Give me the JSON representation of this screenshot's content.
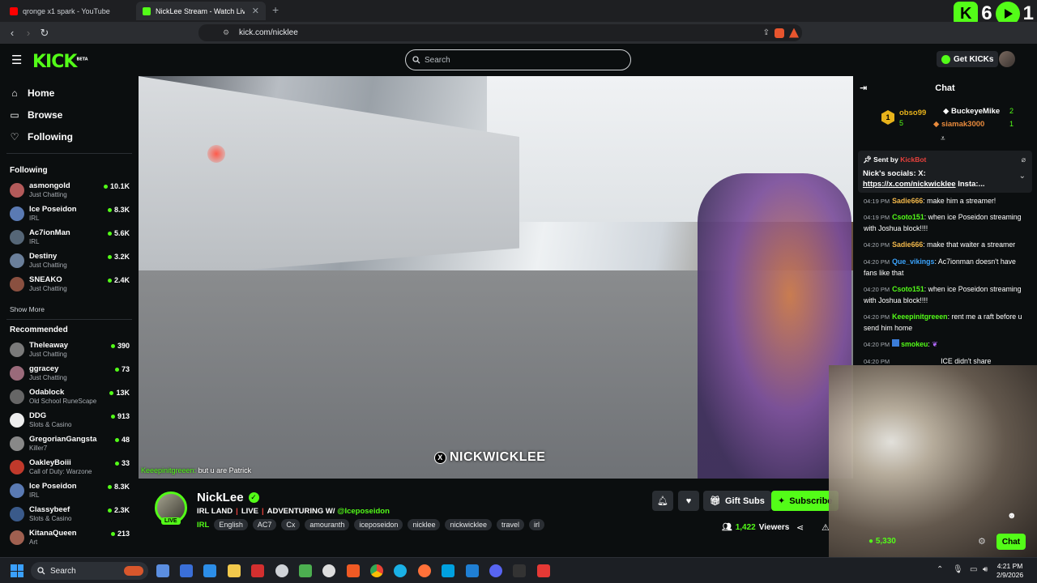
{
  "browser": {
    "tabs": [
      {
        "title": "qronge x1 spark - YouTube",
        "favicon_color": "#ff0000",
        "active": false
      },
      {
        "title": "NickLee Stream - Watch Live",
        "favicon_color": "#53fc18",
        "active": true
      }
    ],
    "new_tab": "+",
    "url": "kick.com/nicklee",
    "overlay_counts": {
      "left": "6",
      "right": "1"
    }
  },
  "header": {
    "logo": "KICK",
    "logo_beta": "BETA",
    "search_placeholder": "Search",
    "get_kicks": "Get KICKs"
  },
  "sidebar": {
    "nav": [
      {
        "label": "Home",
        "icon": "home-icon"
      },
      {
        "label": "Browse",
        "icon": "browse-icon"
      },
      {
        "label": "Following",
        "icon": "heart-icon"
      }
    ],
    "following_title": "Following",
    "following": [
      {
        "name": "asmongold",
        "category": "Just Chatting",
        "viewers": "10.1K",
        "color": "#b35a5a"
      },
      {
        "name": "Ice Poseidon",
        "category": "IRL",
        "viewers": "8.3K",
        "color": "#5a7ab3"
      },
      {
        "name": "Ac7ionMan",
        "category": "IRL",
        "viewers": "5.6K",
        "color": "#556677"
      },
      {
        "name": "Destiny",
        "category": "Just Chatting",
        "viewers": "3.2K",
        "color": "#6a7f9a"
      },
      {
        "name": "SNEAKO",
        "category": "Just Chatting",
        "viewers": "2.4K",
        "color": "#8a5040"
      }
    ],
    "show_more": "Show More",
    "recommended_title": "Recommended",
    "recommended": [
      {
        "name": "Theleaway",
        "category": "Just Chatting",
        "viewers": "390",
        "color": "#7a7a7a"
      },
      {
        "name": "ggracey",
        "category": "Just Chatting",
        "viewers": "73",
        "color": "#9a6a7a"
      },
      {
        "name": "Odablock",
        "category": "Old School RuneScape",
        "viewers": "13K",
        "color": "#666"
      },
      {
        "name": "DDG",
        "category": "Slots & Casino",
        "viewers": "913",
        "color": "#eee"
      },
      {
        "name": "GregorianGangsta",
        "category": "Killer7",
        "viewers": "48",
        "color": "#888"
      },
      {
        "name": "OakleyBoiii",
        "category": "Call of Duty: Warzone",
        "viewers": "33",
        "color": "#c0392b"
      },
      {
        "name": "Ice Poseidon",
        "category": "IRL",
        "viewers": "8.3K",
        "color": "#5a7ab3"
      },
      {
        "name": "Classybeef",
        "category": "Slots & Casino",
        "viewers": "2.3K",
        "color": "#3a5a8a"
      },
      {
        "name": "KitanaQueen",
        "category": "Art",
        "viewers": "213",
        "color": "#a06050"
      }
    ]
  },
  "video": {
    "watermark": "NICKWICKLEE",
    "overlay_chat_user": "Keeepinitgreeen:",
    "overlay_chat_text": "but u are Patrick"
  },
  "stream": {
    "streamer": "NickLee",
    "live_badge": "LIVE",
    "title_parts": [
      "IRL LAND",
      "LIVE",
      "ADVENTURING W/"
    ],
    "title_mention": "@Iceposeidon",
    "title_sep": "|",
    "category": "IRL",
    "tags": [
      "English",
      "AC7",
      "Cx",
      "amouranth",
      "iceposeidon",
      "nicklee",
      "nickwicklee",
      "travel",
      "irl"
    ],
    "gift_label": "Gift Subs",
    "subscribe_label": "Subscribe",
    "viewers": "1,422",
    "viewers_label": "Viewers"
  },
  "chat": {
    "title": "Chat",
    "leaderboard": [
      {
        "rank": "1",
        "name": "obso99",
        "count": "5",
        "color": "#e7b21b"
      },
      {
        "name": "BuckeyeMike",
        "count": "2",
        "color": "#ffffff"
      },
      {
        "name": "siamak3000",
        "count": "1",
        "color": "#e88a3c"
      }
    ],
    "pinned": {
      "sent_by": "Sent by",
      "bot": "KickBot",
      "message": "Nick's socials: X:",
      "link": "https://x.com/nickwicklee",
      "tail": "Insta:..."
    },
    "messages": [
      {
        "time": "04:19 PM",
        "user": "Sadie666",
        "color": "#f2b84b",
        "text": "make him a streamer!"
      },
      {
        "time": "04:19 PM",
        "user": "Csoto151",
        "color": "#53fc18",
        "text": "when ice Poseidon streaming with Joshua block!!!!"
      },
      {
        "time": "04:20 PM",
        "user": "Sadie666",
        "color": "#f2b84b",
        "text": "make that waiter a streamer"
      },
      {
        "time": "04:20 PM",
        "user": "Que_vikings",
        "color": "#3ba5ff",
        "text": "Ac7ionman doesn't have fans like that"
      },
      {
        "time": "04:20 PM",
        "user": "Csoto151",
        "color": "#53fc18",
        "text": "when ice Poseidon streaming with Joshua block!!!!"
      },
      {
        "time": "04:20 PM",
        "user": "Keeepinitgreeen",
        "color": "#53fc18",
        "text": "rent me a raft before u send him home"
      },
      {
        "time": "04:20 PM",
        "user": "smokeu",
        "color": "#53fc18",
        "text": ""
      },
      {
        "time": "04:20 PM",
        "user": "",
        "color": "#ffffff",
        "text": "ICE didn't share"
      }
    ],
    "kick_points": "5,330",
    "chat_button": "Chat"
  },
  "taskbar": {
    "search": "Search",
    "time": "4:21 PM",
    "date": "2/9/2026"
  }
}
